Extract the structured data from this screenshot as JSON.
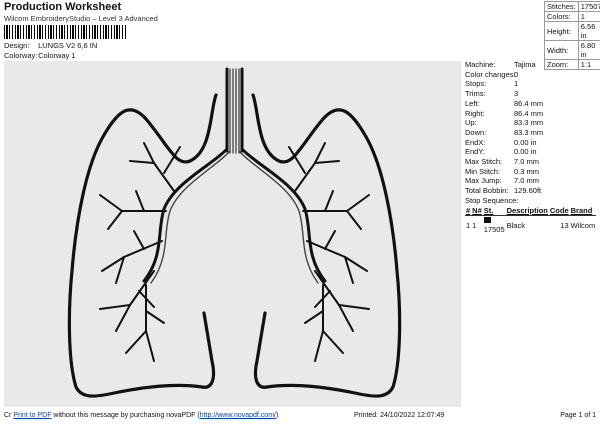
{
  "header": {
    "title": "Production Worksheet",
    "subtitle": "Wilcom EmbroideryStudio – Level 3 Advanced",
    "design_label": "Design:",
    "design_value": "LUNGS V2 6,6 IN",
    "colorway_label": "Colorway:",
    "colorway_value": "Colorway 1"
  },
  "stats": [
    {
      "label": "Stitches:",
      "value": "17507"
    },
    {
      "label": "Colors:",
      "value": "1"
    },
    {
      "label": "Height:",
      "value": "6.56 in"
    },
    {
      "label": "Width:",
      "value": "6.80 in"
    },
    {
      "label": "Zoom:",
      "value": "1:1"
    }
  ],
  "params": [
    {
      "label": "Machine:",
      "value": "Tajima"
    },
    {
      "label": "Color changes:",
      "value": "0"
    },
    {
      "label": "Stops:",
      "value": "1"
    },
    {
      "label": "Trims:",
      "value": "3"
    },
    {
      "label": "Left:",
      "value": "86.4 mm"
    },
    {
      "label": "Right:",
      "value": "86.4 mm"
    },
    {
      "label": "Up:",
      "value": "83.3 mm"
    },
    {
      "label": "Down:",
      "value": "83.3 mm"
    },
    {
      "label": "EndX:",
      "value": "0.00 in"
    },
    {
      "label": "EndY:",
      "value": "0.00 in"
    },
    {
      "label": "Max Stitch:",
      "value": "7.0 mm"
    },
    {
      "label": "Min Stitch:",
      "value": "0.3 mm"
    },
    {
      "label": "Max Jump:",
      "value": "7.0 mm"
    },
    {
      "label": "Total Bobbin:",
      "value": "129.60ft"
    }
  ],
  "stop_sequence": {
    "heading": "Stop Sequence:",
    "columns": [
      "#",
      "N#",
      "St.",
      "Description",
      "Code",
      "Brand"
    ],
    "rows": [
      {
        "num": "1",
        "n": "1",
        "stitches": "17505",
        "description": "Black",
        "code": "13",
        "brand": "Wilcom",
        "color": "#111111"
      }
    ]
  },
  "footer": {
    "prefix": "Cr",
    "link_text": "Print to PDF",
    "message": " without this message by purchasing novaPDF (",
    "url_text": "http://www.novapdf.com/",
    "suffix": ")",
    "printed": "Printed: 24/10/2022 12:07:49",
    "page": "Page 1 of 1"
  },
  "colors": {
    "thread": "#3a3a3a",
    "canvas": "#e9e9e9"
  }
}
